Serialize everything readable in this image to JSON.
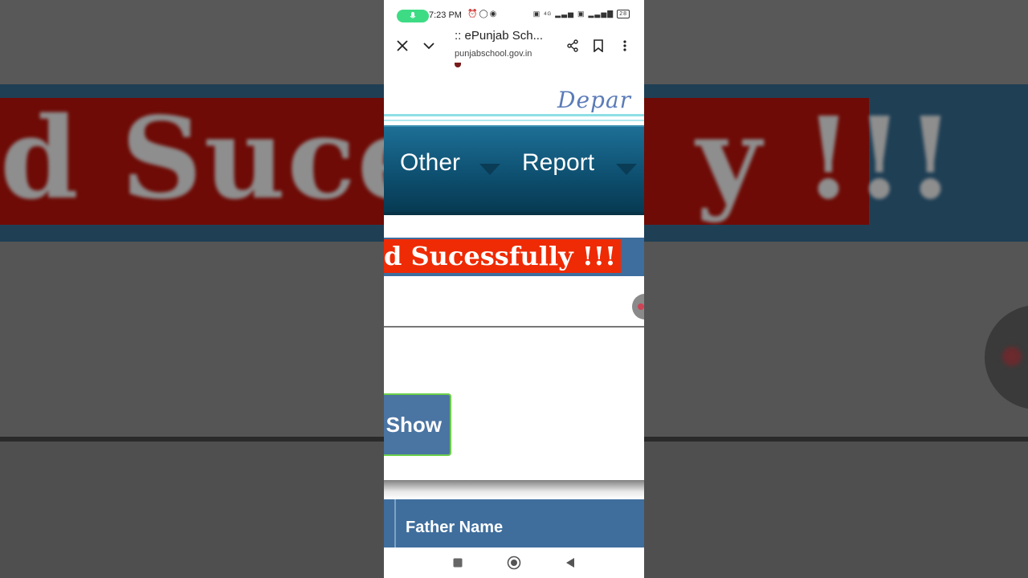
{
  "background": {
    "blurred_text": "d Suces",
    "blurred_text_tail": "y !!!"
  },
  "statusbar": {
    "time": "7:23 PM",
    "battery": "28",
    "network": "4G"
  },
  "browser": {
    "title": ":: ePunjab Sch...",
    "url": "punjabschool.gov.in"
  },
  "page": {
    "department_text": "Depar",
    "nav": [
      {
        "label": "Other"
      },
      {
        "label": "Report"
      }
    ],
    "banner_text": "d Sucessfully !!!",
    "show_button": "Show",
    "table": {
      "header": "Father Name"
    }
  },
  "colors": {
    "nav_blue": "#0d4e6e",
    "banner_red": "#ee2b05",
    "banner_blue": "#3d6e9e",
    "button_blue": "#4a74a2",
    "button_border": "#6ccf4a"
  }
}
